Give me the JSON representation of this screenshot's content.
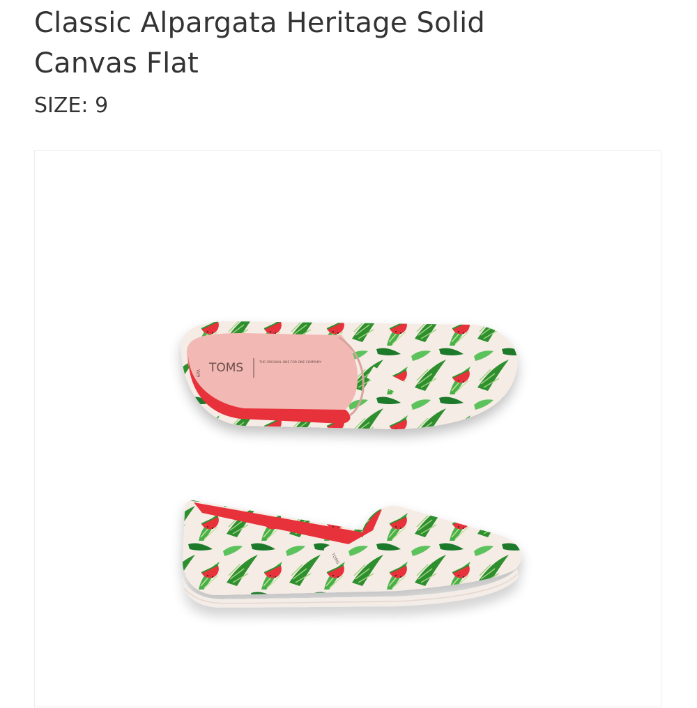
{
  "product": {
    "title": "Classic Alpargata Heritage Solid Canvas Flat",
    "size_label": "SIZE:",
    "size_value": "9"
  },
  "image": {
    "description_icon": "product-photo",
    "insole_brand": "TOMS",
    "insole_size": "W9",
    "insole_tagline": "THE ORIGINAL ONE FOR ONE COMPANY",
    "heel_tag": "TOMS"
  },
  "colors": {
    "text": "#333333",
    "frame_border": "#ececec",
    "leaf_green": "#3a9e3a",
    "watermelon_red": "#e8313a",
    "canvas_cream": "#f6ece6"
  }
}
